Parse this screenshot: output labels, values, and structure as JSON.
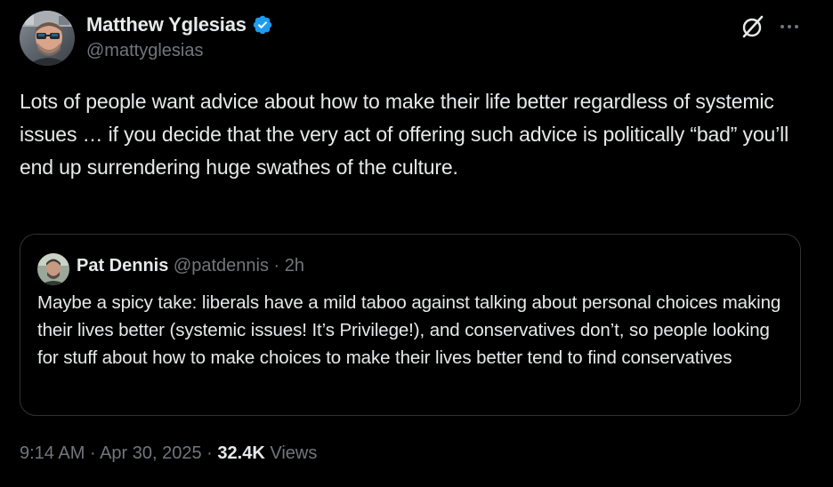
{
  "colors": {
    "background": "#000000",
    "text_primary": "#e7e9ea",
    "text_secondary": "#71767b",
    "verified_badge": "#1d9bf0",
    "card_border": "#2f3336"
  },
  "author": {
    "display_name": "Matthew Yglesias",
    "handle": "@mattyglesias",
    "verified": true,
    "avatar_icon": "profile-photo"
  },
  "header_actions": {
    "grok_icon": "grok-slash-icon",
    "more_icon": "more-dots-icon"
  },
  "tweet": {
    "text": "Lots of people want advice about how to make their life better regardless of systemic issues … if you decide that the very act of offering such advice is politically “bad” you’ll end up surrendering huge swathes of the culture."
  },
  "quoted_tweet": {
    "display_name": "Pat Dennis",
    "handle": "@patdennis",
    "separator": "·",
    "time": "2h",
    "avatar_icon": "profile-photo",
    "text": "Maybe a spicy take: liberals have a mild taboo against talking about personal choices making their lives better (systemic issues! It’s Privilege!), and conservatives don’t, so people looking for stuff about how to make choices to make their lives better tend to find conservatives"
  },
  "meta": {
    "time": "9:14 AM",
    "separator": "·",
    "date": "Apr 30, 2025",
    "views_count": "32.4K",
    "views_label": "Views"
  }
}
